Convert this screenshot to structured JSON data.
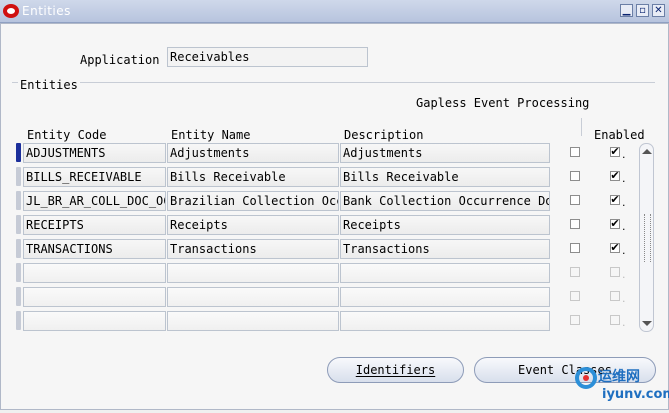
{
  "window": {
    "title": "Entities",
    "controls": [
      "minimize-icon",
      "maximize-icon",
      "close-icon"
    ]
  },
  "application": {
    "label": "Application",
    "value": "Receivables"
  },
  "section": {
    "label": "Entities",
    "gapless_label": "Gapless Event Processing"
  },
  "columns": {
    "entity_code": "Entity Code",
    "entity_name": "Entity Name",
    "description": "Description",
    "enabled": "Enabled"
  },
  "rows": [
    {
      "code": "ADJUSTMENTS",
      "name": "Adjustments",
      "description": "Adjustments",
      "gapless": false,
      "enabled": true,
      "current": true
    },
    {
      "code": "BILLS_RECEIVABLE",
      "name": "Bills Receivable",
      "description": "Bills Receivable",
      "gapless": false,
      "enabled": true,
      "current": false
    },
    {
      "code": "JL_BR_AR_COLL_DOC_OCC",
      "name": "Brazilian Collection Occ",
      "description": "Bank Collection Occurrence Doc",
      "gapless": false,
      "enabled": true,
      "current": false
    },
    {
      "code": "RECEIPTS",
      "name": "Receipts",
      "description": "Receipts",
      "gapless": false,
      "enabled": true,
      "current": false
    },
    {
      "code": "TRANSACTIONS",
      "name": "Transactions",
      "description": "Transactions",
      "gapless": false,
      "enabled": true,
      "current": false
    },
    {
      "code": "",
      "name": "",
      "description": "",
      "gapless": false,
      "enabled": false,
      "current": false
    },
    {
      "code": "",
      "name": "",
      "description": "",
      "gapless": false,
      "enabled": false,
      "current": false
    },
    {
      "code": "",
      "name": "",
      "description": "",
      "gapless": false,
      "enabled": false,
      "current": false
    }
  ],
  "buttons": {
    "identifiers": "Identifiers",
    "event_classes": "Event Classes"
  },
  "watermark": {
    "text_cn": "运维网",
    "text_en": "iyunv.com"
  }
}
